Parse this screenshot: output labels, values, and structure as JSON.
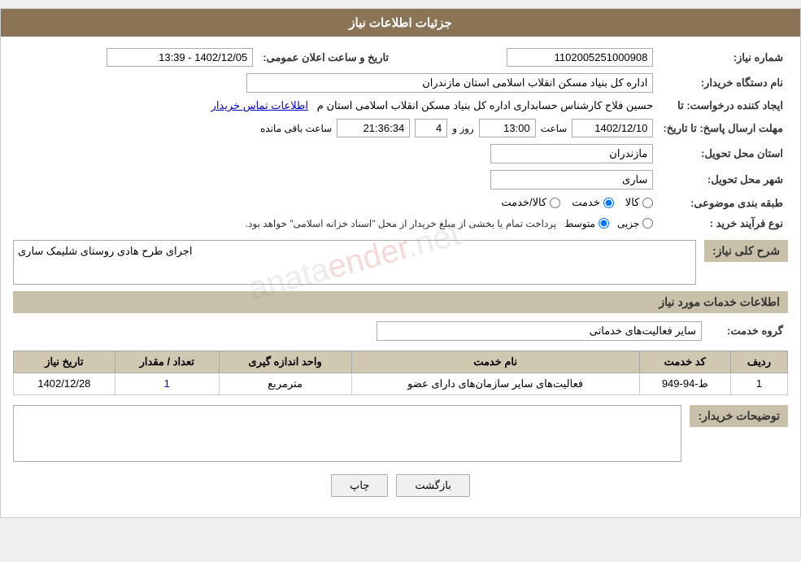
{
  "page": {
    "title": "جزئیات اطلاعات نیاز"
  },
  "header": {
    "announcement_number_label": "شماره نیاز:",
    "announcement_number_value": "1102005251000908",
    "announcement_datetime_label": "تاریخ و ساعت اعلان عمومی:",
    "announcement_datetime_value": "1402/12/05 - 13:39",
    "buyer_org_label": "نام دستگاه خریدار:",
    "buyer_org_value": "اداره کل بنیاد مسکن انقلاب اسلامی استان مازندران",
    "creator_label": "ایجاد کننده درخواست: تا",
    "creator_value": "حسین فلاح کارشناس حسابداری اداره کل بنیاد مسکن انقلاب اسلامی استان م",
    "creator_link": "اطلاعات تماس خریدار",
    "response_deadline_label": "مهلت ارسال پاسخ: تا تاریخ:",
    "response_date_value": "1402/12/10",
    "response_time_label": "ساعت",
    "response_time_value": "13:00",
    "response_day_label": "روز و",
    "response_day_value": "4",
    "response_remaining_label": "ساعت باقی مانده",
    "response_remaining_value": "21:36:34",
    "delivery_province_label": "استان محل تحویل:",
    "delivery_province_value": "مازندران",
    "delivery_city_label": "شهر محل تحویل:",
    "delivery_city_value": "ساری",
    "subject_classification_label": "طبقه بندی موضوعی:",
    "subject_options": [
      {
        "label": "کالا",
        "value": "kala",
        "selected": false
      },
      {
        "label": "خدمت",
        "value": "khadamat",
        "selected": true
      },
      {
        "label": "کالا/خدمت",
        "value": "kala_khadamat",
        "selected": false
      }
    ],
    "purchase_type_label": "نوع فرآیند خرید :",
    "purchase_options": [
      {
        "label": "جزیی",
        "value": "jozi",
        "selected": false
      },
      {
        "label": "متوسط",
        "value": "motavaset",
        "selected": true
      }
    ],
    "purchase_note": "پرداخت تمام یا بخشی از مبلغ خریدار از محل \"اسناد خزانه اسلامی\" خواهد بود."
  },
  "need_description": {
    "section_title": "شرح کلی نیاز:",
    "value": "اجرای طرح هادی روستای شلیمک ساری"
  },
  "service_info": {
    "section_title": "اطلاعات خدمات مورد نیاز",
    "service_group_label": "گروه خدمت:",
    "service_group_value": "سایر فعالیت‌های خدماتی",
    "table_headers": [
      "ردیف",
      "کد خدمت",
      "نام خدمت",
      "واحد اندازه گیری",
      "تعداد / مقدار",
      "تاریخ نیاز"
    ],
    "table_rows": [
      {
        "row": "1",
        "code": "ط-94-949",
        "name": "فعالیت‌های سایر سازمان‌های دارای عضو",
        "unit": "مترمربع",
        "quantity": "1",
        "date": "1402/12/28"
      }
    ]
  },
  "buyer_description": {
    "section_title": "توضیحات خریدار:",
    "value": ""
  },
  "buttons": {
    "print_label": "چاپ",
    "back_label": "بازگشت"
  }
}
